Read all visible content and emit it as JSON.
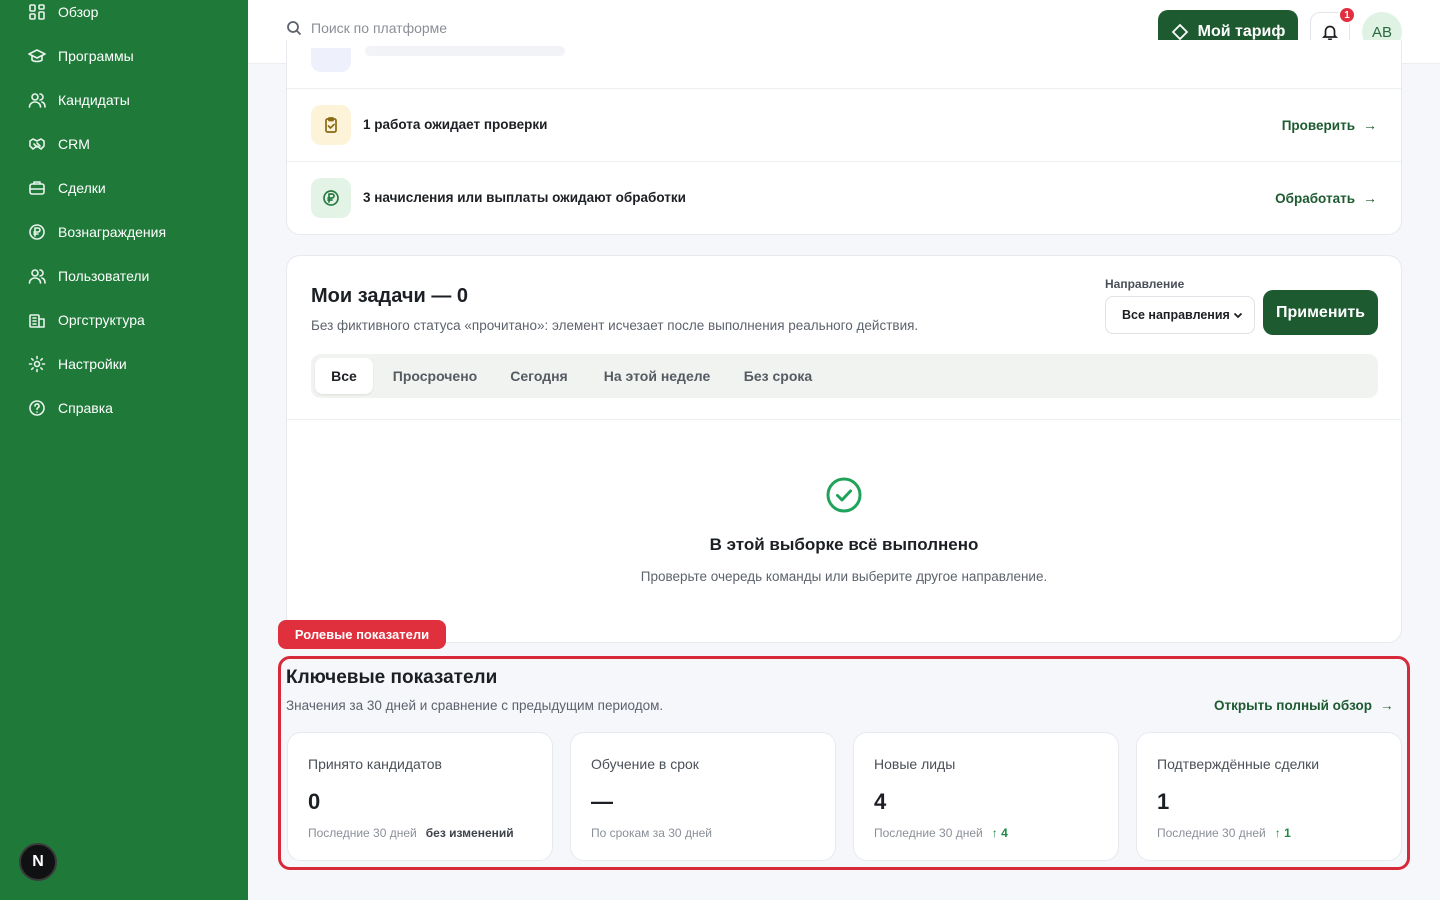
{
  "sidebar": {
    "items": [
      {
        "label": "Обзор",
        "icon": "grid-icon"
      },
      {
        "label": "Программы",
        "icon": "graduation-cap-icon"
      },
      {
        "label": "Кандидаты",
        "icon": "users-icon"
      },
      {
        "label": "CRM",
        "icon": "handshake-icon"
      },
      {
        "label": "Сделки",
        "icon": "briefcase-icon"
      },
      {
        "label": "Вознаграждения",
        "icon": "ruble-coin-icon"
      },
      {
        "label": "Пользователи",
        "icon": "user-group-icon"
      },
      {
        "label": "Оргструктура",
        "icon": "building-icon"
      },
      {
        "label": "Настройки",
        "icon": "gear-icon"
      },
      {
        "label": "Справка",
        "icon": "help-circle-icon"
      }
    ],
    "badge": "N"
  },
  "header": {
    "search_placeholder": "Поиск по платформе",
    "plan_label": "Мой тариф",
    "notifications_count": "1",
    "avatar_initials": "AB"
  },
  "pending": {
    "rows": [
      {
        "text": "1 работа ожидает проверки",
        "action": "Проверить",
        "icon": "clipboard-check-icon",
        "icon_bg": "#fdf3d8",
        "icon_color": "#8a6a14"
      },
      {
        "text": "3 начисления или выплаты ожидают обработки",
        "action": "Обработать",
        "icon": "ruble-coin-icon",
        "icon_bg": "#e3f4e7",
        "icon_color": "#2a7a45"
      }
    ]
  },
  "tasks": {
    "title": "Мои задачи — 0",
    "subtitle": "Без фиктивного статуса «прочитано»: элемент исчезает после выполнения реального действия.",
    "direction_label": "Направление",
    "direction_value": "Все направления",
    "apply_label": "Применить",
    "tabs": [
      {
        "label": "Все",
        "active": true
      },
      {
        "label": "Просрочено",
        "active": false
      },
      {
        "label": "Сегодня",
        "active": false
      },
      {
        "label": "На этой неделе",
        "active": false
      },
      {
        "label": "Без срока",
        "active": false
      }
    ],
    "empty_title": "В этой выборке всё выполнено",
    "empty_subtitle": "Проверьте очередь команды или выберите другое направление."
  },
  "kpi": {
    "role_tag": "Ролевые показатели",
    "title": "Ключевые показатели",
    "subtitle": "Значения за 30 дней и сравнение с предыдущим периодом.",
    "link_label": "Открыть полный обзор",
    "cards": [
      {
        "label": "Принято кандидатов",
        "value": "0",
        "note": "Последние 30 дней",
        "delta": "без изменений"
      },
      {
        "label": "Обучение в срок",
        "value": "—",
        "note": "По срокам за 30 дней",
        "delta": ""
      },
      {
        "label": "Новые лиды",
        "value": "4",
        "note": "Последние 30 дней",
        "delta": "↑ 4"
      },
      {
        "label": "Подтверждённые сделки",
        "value": "1",
        "note": "Последние 30 дней",
        "delta": "↑ 1"
      }
    ]
  },
  "colors": {
    "sidebar_bg": "#1f7a3a",
    "primary_button": "#1d5a30",
    "accent_red": "#e0303e",
    "success": "#1fa35a"
  }
}
